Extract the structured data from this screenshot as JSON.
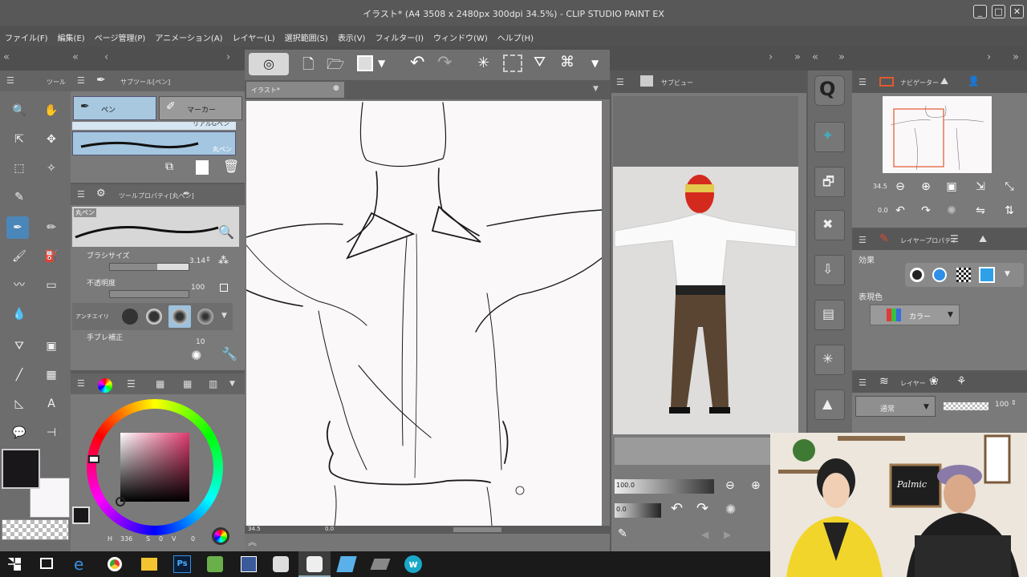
{
  "window": {
    "title": "イラスト* (A4 3508 x 2480px 300dpi 34.5%) - CLIP STUDIO PAINT EX",
    "controls": [
      "_",
      "□",
      "✕"
    ]
  },
  "menu": [
    "ファイル(F)",
    "編集(E)",
    "ページ管理(P)",
    "アニメーション(A)",
    "レイヤー(L)",
    "選択範囲(S)",
    "表示(V)",
    "フィルター(I)",
    "ウィンドウ(W)",
    "ヘルプ(H)"
  ],
  "panels": {
    "tool_tab": "ツール",
    "subtool_tab": "サブツール[ペン]",
    "subtool_buttons": [
      "ペン",
      "マーカー"
    ],
    "brush_preview_top_label": "リアルGペン",
    "brush_preset_name": "丸ペン",
    "tool_property_tab": "ツールプロパティ[丸ペン]",
    "tool_property_preset": "丸ペン",
    "brush_size": {
      "label": "ブラシサイズ",
      "value": "3.14",
      "fraction": 0.6
    },
    "opacity": {
      "label": "不透明度",
      "value": "100",
      "fraction": 1.0
    },
    "antialias_label": "アンチエイリ",
    "stabilization": {
      "label": "手ブレ補正",
      "value": "10"
    },
    "color": {
      "main_color": "#1a171b",
      "sub_color": "#f8f6f8",
      "hue_color": "#e03a6e",
      "hsv": {
        "h_label": "H",
        "h": "336",
        "s_label": "S",
        "s": "0",
        "v_label": "V",
        "v": "0"
      }
    },
    "canvas_tab": "イラスト*",
    "canvas_status": {
      "zoom": "34.5",
      "angle": "0.0"
    },
    "subview_tab": "サブビュー",
    "subview_controls": {
      "zoom": "100.0",
      "angle": "0.0"
    },
    "navigator_tab": "ナビゲーター",
    "navigator": {
      "zoom": "34.5",
      "angle": "0.0"
    },
    "layer_property_tab": "レイヤープロパティ",
    "effect_label": "効果",
    "expression_color": {
      "label": "表現色",
      "value": "カラー"
    },
    "layer_tab": "レイヤー",
    "blend_mode": "通常",
    "layer_opacity": "100"
  },
  "webcam": {
    "sign_text": "Palmic"
  },
  "taskbar": {
    "icons": [
      "start-icon",
      "task-view-icon",
      "edge-icon",
      "chrome-icon",
      "explorer-icon",
      "photoshop-icon",
      "app-icon",
      "app-icon-2",
      "clip-studio-icon",
      "clip-studio-active-icon",
      "app-icon-3",
      "app-icon-4",
      "app-icon-5"
    ],
    "ps_label": "Ps",
    "w_label": "w"
  }
}
